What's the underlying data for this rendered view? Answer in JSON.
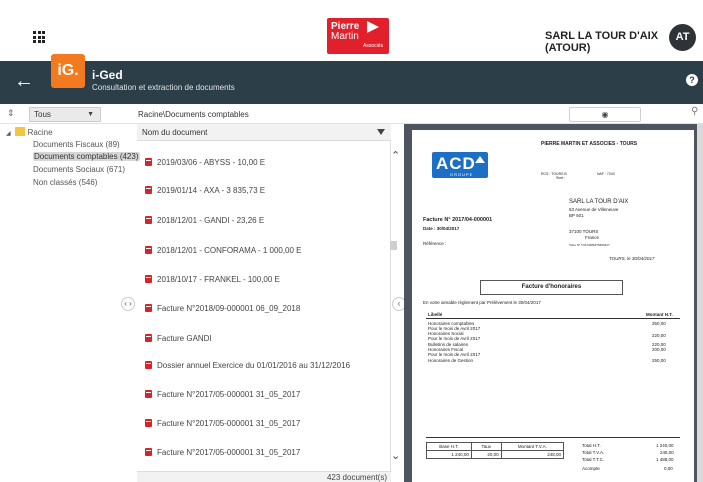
{
  "header": {
    "company_name": "SARL LA TOUR D'AIX (ATOUR)",
    "avatar_initials": "AT",
    "brand_logo": {
      "line1": "Pierre",
      "line2": "Martin",
      "line3": "Associés"
    }
  },
  "app": {
    "logo_text": "iG.",
    "name": "i-Ged",
    "subtitle": "Consultation et extraction de documents",
    "help_label": "?"
  },
  "filter": {
    "selected": "Tous",
    "breadcrumb": "Racine\\Documents comptables"
  },
  "tree": {
    "root": "Racine",
    "items": [
      {
        "label": "Documents Fiscaux (89)",
        "selected": false
      },
      {
        "label": "Documents comptables (423)",
        "selected": true
      },
      {
        "label": "Documents Sociaux (671)",
        "selected": false
      },
      {
        "label": "Non classés (546)",
        "selected": false
      }
    ]
  },
  "list": {
    "header": "Nom du document",
    "documents": [
      "2019/03/06 - ABYSS - 10,00 E",
      "2019/01/14 - AXA - 3 835,73 E",
      "2018/12/01 - GANDI - 23,26 E",
      "2018/12/01 - CONFORAMA - 1 000,00 E",
      "2018/10/17 - FRANKEL - 100,00 E",
      "Facture N°2018/09-000001 06_09_2018",
      "Facture GANDI",
      "Dossier annuel Exercice du 01/01/2016 au 31/12/2016",
      "Facture N°2017/05-000001 31_05_2017",
      "Facture N°2017/05-000001 31_05_2017",
      "Facture N°2017/05-000001 31_05_2017"
    ],
    "footer": "423 document(s)"
  },
  "preview": {
    "logo": {
      "text": "ACD",
      "group": "GROUPE"
    },
    "firm": "PIERRE MARTIN ET ASSOCIES - TOURS",
    "rcs": "RCS : TOURS B",
    "naf": "NAF : 7240",
    "siret": "Siret :",
    "client_name": "SARL LA TOUR D'AIX",
    "client_addr1": "63 Avenue de Villeneuve",
    "client_addr2": "BP 501",
    "client_city": "37100 TOURS",
    "client_country": "France",
    "client_tva": "Votre N° TVA FR86475659447",
    "invoice_no": "Facture N° 2017/04-000001",
    "invoice_date": "Date : 30/04/2017",
    "reference": "Référence :",
    "place_date": "TOURS, le 30/04/2017",
    "title": "Facture d'honoraires",
    "payment": "En votre aimable règlement par Prélèvement le 30/04/2017",
    "col_libelle": "Libellé",
    "col_montant": "Montant H.T.",
    "lines": [
      {
        "label": "Honoraires comptables",
        "sub": "Pour le mois de Avril 2017",
        "amount": "350,00"
      },
      {
        "label": "Honoraires Social",
        "sub": "Pour le mois de Avril 2017",
        "amount": "220,00"
      },
      {
        "label": "Bulletins de salaires",
        "sub": "",
        "amount": "220,00"
      },
      {
        "label": "Honoraires Fiscal",
        "sub": "Pour le mois de Avril 2017",
        "amount": "200,00"
      },
      {
        "label": "Honoraires de Gestion",
        "sub": "",
        "amount": "250,00"
      }
    ],
    "tva_table": {
      "headers": [
        "Base H.T.",
        "Taux",
        "Montant T.V.A."
      ],
      "row": [
        "1 240,00",
        "20,00",
        "248,00"
      ]
    },
    "totals": [
      {
        "label": "Total H.T.",
        "value": "1 240,00"
      },
      {
        "label": "Total T.V.A.",
        "value": "248,00"
      },
      {
        "label": "Total T.T.C.",
        "value": "1 488,00"
      },
      {
        "label": "Acompte",
        "value": "0,00"
      }
    ]
  }
}
